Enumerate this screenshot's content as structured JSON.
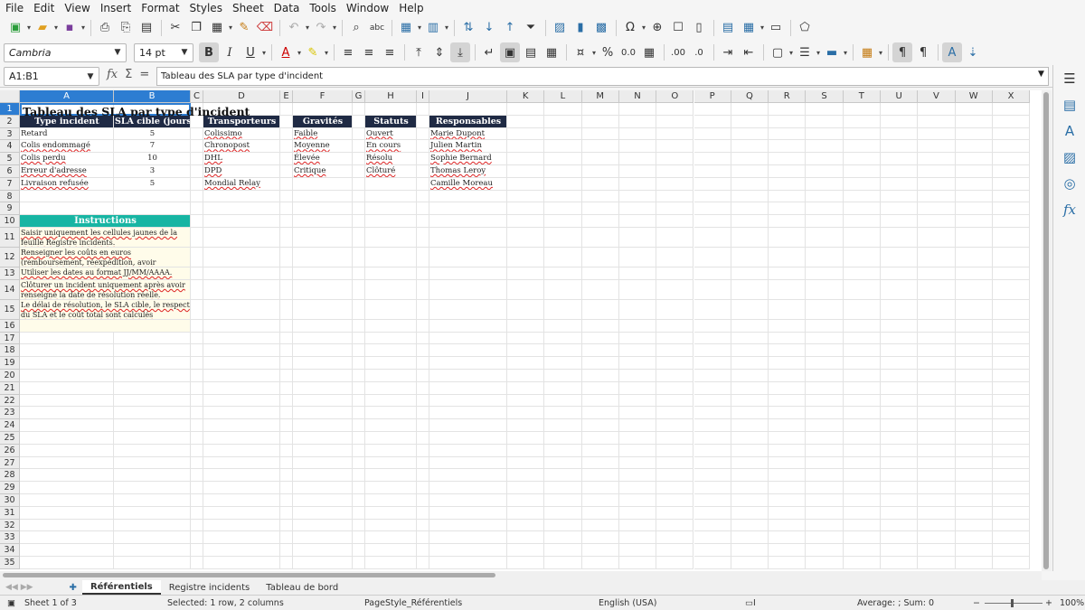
{
  "menu": [
    "File",
    "Edit",
    "View",
    "Insert",
    "Format",
    "Styles",
    "Sheet",
    "Data",
    "Tools",
    "Window",
    "Help"
  ],
  "toolbar": {
    "font_name": "Cambria",
    "font_size": "14 pt"
  },
  "formula_bar": {
    "name_box": "A1:B1",
    "content": "Tableau des SLA par type d'incident"
  },
  "columns": [
    "A",
    "B",
    "C",
    "D",
    "E",
    "F",
    "G",
    "H",
    "I",
    "J",
    "K",
    "L",
    "M",
    "N",
    "O",
    "P",
    "Q",
    "R",
    "S",
    "T",
    "U",
    "V",
    "W",
    "X"
  ],
  "rows": [
    "1",
    "2",
    "3",
    "4",
    "5",
    "6",
    "7",
    "8",
    "9",
    "10",
    "11",
    "12",
    "13",
    "14",
    "15",
    "16",
    "17",
    "18",
    "19",
    "20",
    "21",
    "22",
    "23",
    "24",
    "25",
    "26",
    "27",
    "28",
    "29",
    "30",
    "31",
    "32",
    "33",
    "34",
    "35"
  ],
  "sheet": {
    "title": "Tableau des SLA par type d'incident",
    "sla_headers": [
      "Type incident",
      "SLA cible (jours)"
    ],
    "sla_rows": [
      [
        "Retard",
        "5"
      ],
      [
        "Colis endommagé",
        "7"
      ],
      [
        "Colis perdu",
        "10"
      ],
      [
        "Erreur d'adresse",
        "3"
      ],
      [
        "Livraison refusée",
        "5"
      ]
    ],
    "transporteurs": {
      "header": "Transporteurs",
      "items": [
        "Colissimo",
        "Chronopost",
        "DHL",
        "DPD",
        "Mondial Relay"
      ]
    },
    "gravites": {
      "header": "Gravités",
      "items": [
        "Faible",
        "Moyenne",
        "Élevée",
        "Critique"
      ]
    },
    "statuts": {
      "header": "Statuts",
      "items": [
        "Ouvert",
        "En cours",
        "Résolu",
        "Clôturé"
      ]
    },
    "responsables": {
      "header": "Responsables",
      "items": [
        "Marie Dupont",
        "Julien Martin",
        "Sophie Bernard",
        "Thomas Leroy",
        "Camille Moreau"
      ]
    },
    "instructions": {
      "header": "Instructions",
      "lines": [
        "Saisir uniquement les cellules jaunes de la feuille Registre incidents.",
        "Renseigner les coûts en euros (remboursement, réexpédition, avoir commercial).",
        "Utiliser les dates au format JJ/MM/AAAA.",
        "Clôturer un incident uniquement après avoir renseigné la date de résolution réelle.",
        "Le délai de résolution, le SLA cible, le respect du SLA et le coût total sont calculés automatiquement."
      ]
    }
  },
  "tabs": [
    "Référentiels",
    "Registre incidents",
    "Tableau de bord"
  ],
  "status": {
    "sheet": "Sheet 1 of 3",
    "selection": "Selected: 1 row, 2 columns",
    "page_style": "PageStyle_Référentiels",
    "language": "English (USA)",
    "summary": "Average: ; Sum: 0",
    "zoom": "100%"
  }
}
